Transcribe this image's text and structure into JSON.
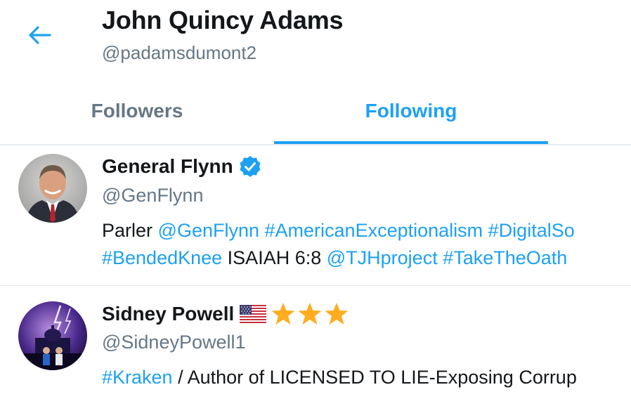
{
  "header": {
    "title": "John Quincy Adams",
    "handle": "@padamsdumont2"
  },
  "tabs": [
    {
      "label": "Followers",
      "active": false
    },
    {
      "label": "Following",
      "active": true
    }
  ],
  "colors": {
    "accent": "#1da1f2",
    "secondary_text": "#657786",
    "primary_text": "#14171a",
    "star": "#ffad1f"
  },
  "users": [
    {
      "name": "General Flynn",
      "verified": true,
      "handle": "@GenFlynn",
      "bio_line1": [
        {
          "text": "Parler ",
          "link": false
        },
        {
          "text": "@GenFlynn",
          "link": true
        },
        {
          "text": " ",
          "link": false
        },
        {
          "text": "#AmericanExceptionalism",
          "link": true
        },
        {
          "text": " ",
          "link": false
        },
        {
          "text": "#DigitalSo",
          "link": true
        }
      ],
      "bio_line2": [
        {
          "text": "#BendedKnee",
          "link": true
        },
        {
          "text": " ISAIAH 6:8 ",
          "link": false
        },
        {
          "text": "@TJHproject",
          "link": true
        },
        {
          "text": " ",
          "link": false
        },
        {
          "text": "#TakeTheOath",
          "link": true
        }
      ]
    },
    {
      "name": "Sidney Powell",
      "emoji": [
        "us-flag-icon",
        "star-icon",
        "star-icon",
        "star-icon"
      ],
      "handle": "@SidneyPowell1",
      "bio_line1": [
        {
          "text": "#Kraken",
          "link": true
        },
        {
          "text": " / Author of LICENSED TO LIE-Exposing Corrup",
          "link": false
        }
      ]
    }
  ]
}
